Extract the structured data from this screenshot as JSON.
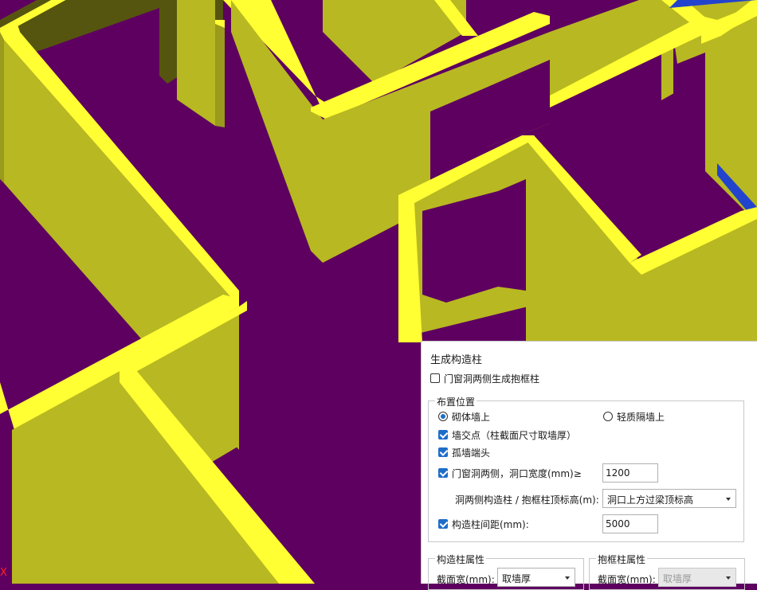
{
  "viewport": {
    "floor_color": "#5e0060",
    "wall_top_color": "#ffff33",
    "wall_face_color": "#b8b822",
    "wall_dark_color": "#55550f",
    "axis_label": "X"
  },
  "dialog": {
    "title": "生成构造柱",
    "frame_columns_checkbox": {
      "label": "门窗洞两侧生成抱框柱",
      "checked": false
    },
    "placement": {
      "title": "布置位置",
      "radio_masonry": {
        "label": "砌体墙上",
        "selected": true
      },
      "radio_light": {
        "label": "轻质隔墙上",
        "selected": false
      },
      "wall_intersection": {
        "label": "墙交点（柱截面尺寸取墙厚）",
        "checked": true
      },
      "isolated_wall_end": {
        "label": "孤墙端头",
        "checked": true
      },
      "opening_sides": {
        "label": "门窗洞两侧，洞口宽度(mm)≥",
        "checked": true,
        "value": "1200"
      },
      "top_elevation": {
        "label": "洞两侧构造柱 / 抱框柱顶标高(m):",
        "value": "洞口上方过梁顶标高"
      },
      "spacing": {
        "label": "构造柱间距(mm):",
        "checked": true,
        "value": "5000"
      }
    },
    "column_props": {
      "title": "构造柱属性",
      "section_width_label": "截面宽(mm):",
      "section_width_value": "取墙厚"
    },
    "frame_props": {
      "title": "抱框柱属性",
      "section_width_label": "截面宽(mm):",
      "section_width_value": "取墙厚"
    }
  }
}
